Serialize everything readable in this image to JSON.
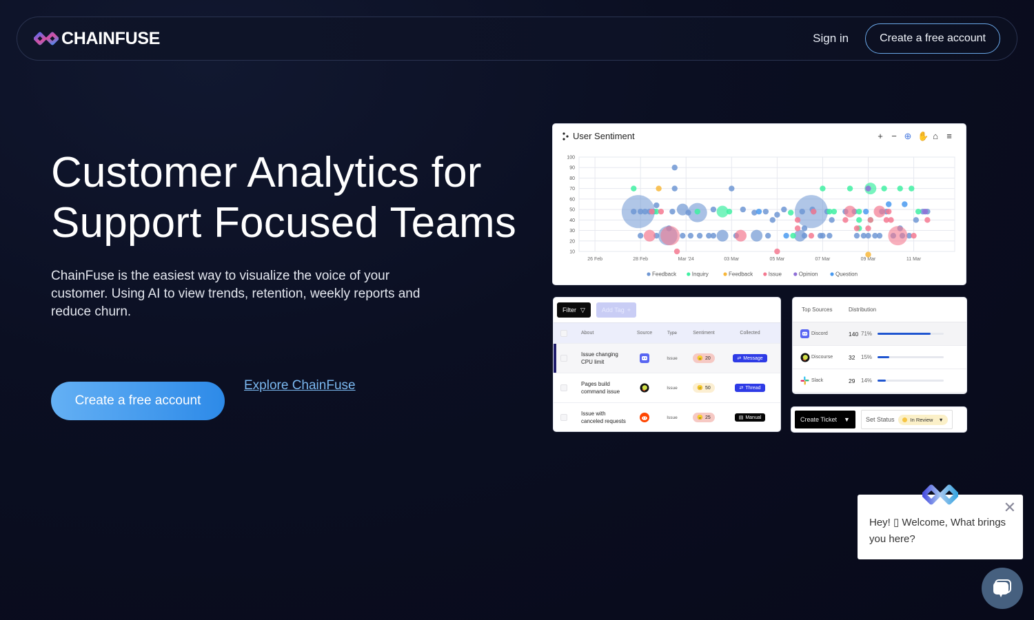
{
  "nav": {
    "brand": "CHAINFUSE",
    "signin_label": "Sign in",
    "cta_label": "Create a free account"
  },
  "hero": {
    "title_line1": "Customer Analytics for",
    "title_line2": "Support Focused Teams",
    "description": "ChainFuse is the easiest way to visualize the voice of your customer. Using AI to view trends, retention, weekly reports and reduce churn.",
    "cta_label": "Create a free account",
    "explore_label": "Explore ChainFuse"
  },
  "chart_card": {
    "title": "User Sentiment",
    "tools": [
      "zoom-in",
      "zoom-out",
      "selection-zoom",
      "pan",
      "reset",
      "menu"
    ]
  },
  "chart_data": {
    "type": "scatter",
    "title": "User Sentiment",
    "xlabel": "",
    "ylabel": "",
    "x_ticks": [
      "26 Feb",
      "28 Feb",
      "Mar '24",
      "03 Mar",
      "05 Mar",
      "07 Mar",
      "09 Mar",
      "11 Mar"
    ],
    "x_range_days": [
      -0.7,
      15.8
    ],
    "ylim": [
      10,
      100
    ],
    "y_ticks": [
      10,
      20,
      30,
      40,
      50,
      60,
      70,
      80,
      90,
      100
    ],
    "grid": true,
    "legend_position": "bottom",
    "x_unit": "days since 26 Feb",
    "series": [
      {
        "name": "Feedback",
        "color": "#6f97d3",
        "points": [
          [
            1.9,
            48,
            3
          ],
          [
            1.7,
            48,
            0
          ],
          [
            2.0,
            48,
            0
          ],
          [
            2.2,
            48,
            0
          ],
          [
            2.4,
            48,
            0
          ],
          [
            2.6,
            48,
            0
          ],
          [
            3.5,
            90,
            0
          ],
          [
            3.5,
            70,
            0
          ],
          [
            2.7,
            54,
            0
          ],
          [
            3.4,
            48,
            0
          ],
          [
            3.85,
            50,
            1
          ],
          [
            4.1,
            47,
            0
          ],
          [
            4.5,
            47,
            2
          ],
          [
            5.2,
            50,
            0
          ],
          [
            6.0,
            70,
            0
          ],
          [
            3.25,
            32,
            0
          ],
          [
            2.0,
            25,
            0
          ],
          [
            2.7,
            25,
            0
          ],
          [
            3.2,
            25,
            2
          ],
          [
            3.85,
            25,
            0
          ],
          [
            4.2,
            25,
            0
          ],
          [
            4.6,
            25,
            0
          ],
          [
            5.0,
            25,
            0
          ],
          [
            5.2,
            25,
            0
          ],
          [
            5.6,
            25,
            1
          ],
          [
            6.2,
            25,
            0
          ],
          [
            6.5,
            50,
            0
          ],
          [
            7.0,
            47,
            0
          ],
          [
            7.5,
            48,
            0
          ],
          [
            7.8,
            40,
            0
          ],
          [
            8.3,
            50,
            0
          ],
          [
            7.6,
            25,
            0
          ],
          [
            7.1,
            25,
            1
          ],
          [
            8.0,
            45,
            0
          ],
          [
            9.0,
            25,
            1
          ],
          [
            9.2,
            25,
            0
          ],
          [
            9.55,
            50,
            0
          ],
          [
            9.5,
            48,
            3
          ],
          [
            9.2,
            32,
            0
          ],
          [
            9.1,
            48,
            0
          ],
          [
            9.6,
            48,
            0
          ],
          [
            10.2,
            48,
            0
          ],
          [
            9.9,
            25,
            0
          ],
          [
            10.0,
            25,
            0
          ],
          [
            10.3,
            25,
            0
          ],
          [
            10.4,
            40,
            0
          ],
          [
            11.0,
            48,
            0
          ],
          [
            11.4,
            48,
            0
          ],
          [
            11.5,
            25,
            0
          ],
          [
            11.8,
            25,
            0
          ],
          [
            12.0,
            25,
            0
          ],
          [
            12.3,
            25,
            0
          ],
          [
            12.5,
            25,
            0
          ],
          [
            12.6,
            48,
            0
          ],
          [
            12.8,
            48,
            0
          ],
          [
            13.1,
            25,
            0
          ],
          [
            13.4,
            32,
            0
          ],
          [
            13.5,
            25,
            0
          ],
          [
            13.8,
            25,
            0
          ],
          [
            14.1,
            40,
            0
          ],
          [
            14.4,
            48,
            0
          ],
          [
            14.6,
            48,
            0
          ]
        ]
      },
      {
        "name": "Inquiry",
        "color": "#3ff0a2",
        "points": [
          [
            1.7,
            70,
            0
          ],
          [
            2.7,
            48,
            0
          ],
          [
            4.5,
            48,
            0
          ],
          [
            5.6,
            48,
            1
          ],
          [
            5.9,
            48,
            0
          ],
          [
            8.6,
            47,
            0
          ],
          [
            8.7,
            25,
            0
          ],
          [
            10.0,
            70,
            0
          ],
          [
            10.3,
            48,
            0
          ],
          [
            10.5,
            48,
            0
          ],
          [
            11.2,
            70,
            0
          ],
          [
            12.1,
            70,
            1
          ],
          [
            12.7,
            70,
            0
          ],
          [
            13.4,
            70,
            0
          ],
          [
            13.9,
            70,
            0
          ],
          [
            11.6,
            48,
            0
          ],
          [
            11.6,
            40,
            0
          ],
          [
            11.6,
            32,
            0
          ],
          [
            12.1,
            40,
            0
          ],
          [
            14.2,
            48,
            0
          ]
        ]
      },
      {
        "name": "Feedback",
        "color": "#f8b73a",
        "points": [
          [
            2.8,
            70,
            0
          ],
          [
            12.0,
            7,
            0
          ]
        ]
      },
      {
        "name": "Issue",
        "color": "#f47990",
        "points": [
          [
            2.4,
            25,
            1
          ],
          [
            2.5,
            48,
            0
          ],
          [
            2.9,
            48,
            0
          ],
          [
            3.3,
            25,
            2
          ],
          [
            3.6,
            10,
            0
          ],
          [
            6.4,
            25,
            1
          ],
          [
            8.0,
            10,
            0
          ],
          [
            8.9,
            40,
            0
          ],
          [
            8.9,
            32,
            0
          ],
          [
            9.5,
            25,
            0
          ],
          [
            11.2,
            48,
            1
          ],
          [
            11.0,
            40,
            0
          ],
          [
            11.5,
            32,
            0
          ],
          [
            12.1,
            40,
            0
          ],
          [
            12.0,
            32,
            0
          ],
          [
            12.5,
            48,
            1
          ],
          [
            12.8,
            40,
            0
          ],
          [
            13.0,
            40,
            0
          ],
          [
            13.3,
            25,
            2
          ],
          [
            14.0,
            25,
            0
          ],
          [
            14.6,
            40,
            0
          ],
          [
            9.6,
            48,
            0
          ],
          [
            12.9,
            48,
            0
          ]
        ]
      },
      {
        "name": "Opinion",
        "color": "#8f6fd6",
        "points": [
          [
            12.0,
            70,
            0
          ],
          [
            14.5,
            48,
            0
          ]
        ]
      },
      {
        "name": "Question",
        "color": "#4a9af0",
        "points": [
          [
            7.2,
            48,
            0
          ],
          [
            12.9,
            55,
            0
          ],
          [
            13.6,
            55,
            0
          ],
          [
            8.4,
            25,
            0
          ],
          [
            11.9,
            48,
            0
          ]
        ]
      }
    ]
  },
  "table": {
    "filter_label": "Filter",
    "add_tag_label": "Add Tag",
    "columns": [
      "About",
      "Source",
      "Type",
      "Sentiment",
      "Collected"
    ],
    "rows": [
      {
        "about": "Issue changing CPU limit",
        "about_l1": "Issue changing",
        "about_l2": "CPU limit",
        "source": "discord",
        "type": "Issue",
        "sentiment": "20",
        "sentiment_emoji": "😠",
        "sentiment_color": "#f6c9c4",
        "collected": "Message",
        "collected_icon": "⇄",
        "collected_color": "#2e3be6",
        "active": true
      },
      {
        "about": "Pages build command issue",
        "about_l1": "Pages build",
        "about_l2": "command issue",
        "source": "discourse",
        "type": "Issue",
        "sentiment": "50",
        "sentiment_emoji": "😐",
        "sentiment_color": "#fcefd2",
        "collected": "Thread",
        "collected_icon": "⇄",
        "collected_color": "#2e3be6",
        "active": false
      },
      {
        "about": "Issue with canceled requests",
        "about_l1": "Issue with",
        "about_l2": "canceled requests",
        "source": "reddit",
        "type": "Issue",
        "sentiment": "25",
        "sentiment_emoji": "😠",
        "sentiment_color": "#f6c9c4",
        "collected": "Manual",
        "collected_icon": "▤",
        "collected_color": "#050505",
        "active": false
      }
    ]
  },
  "sources": {
    "header_sources": "Top Sources",
    "header_distribution": "Distribution",
    "rows": [
      {
        "name": "Discord",
        "count": "140",
        "percent_label": "71%",
        "bar_fraction": 0.8,
        "active": true
      },
      {
        "name": "Discourse",
        "count": "32",
        "percent_label": "15%",
        "bar_fraction": 0.18,
        "active": false
      },
      {
        "name": "Slack",
        "count": "29",
        "percent_label": "14%",
        "bar_fraction": 0.13,
        "active": false
      }
    ]
  },
  "ticket": {
    "create_label": "Create Ticket",
    "set_status_label": "Set Status",
    "status_value": "In Review",
    "status_color": "#f6c543"
  },
  "chat": {
    "message": "Hey! ▯ Welcome, What brings you here?"
  }
}
